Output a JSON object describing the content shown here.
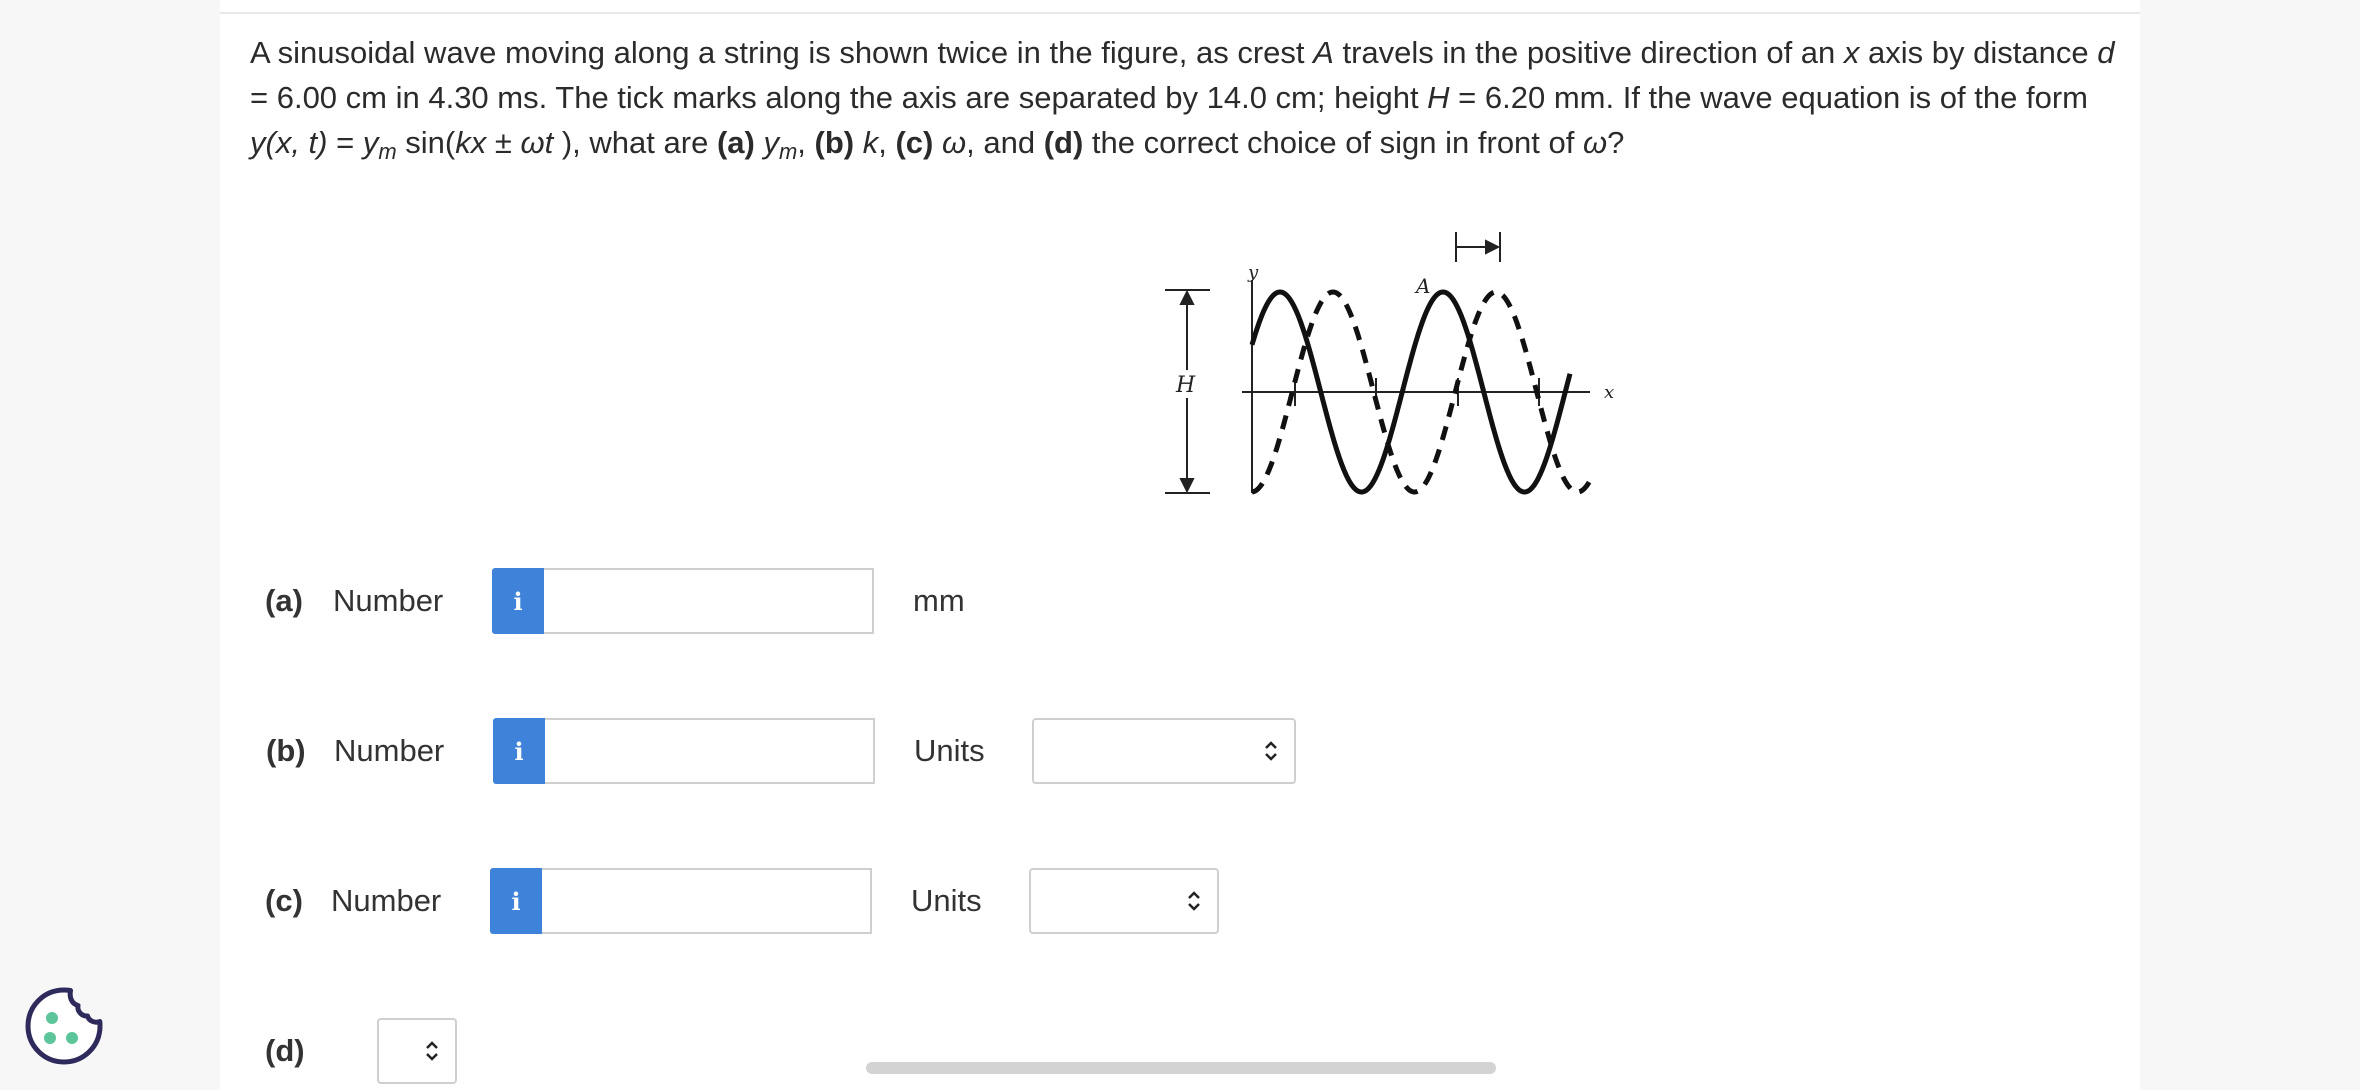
{
  "question": {
    "p1": "A sinusoidal wave moving along a string is shown twice in the figure, as crest ",
    "crest": "A",
    "p2": " travels in the positive direction of an ",
    "xvar": "x",
    "p3": " axis by distance ",
    "dvar": "d",
    "p4": " = 6.00 cm in 4.30 ms. The tick marks along the axis are separated by 14.0 cm; height ",
    "hvar": "H",
    "p5": " = 6.20 mm. If the wave equation is of the form ",
    "eq_y": "y(x, t)",
    "p6": " = ",
    "eq_ym": "y",
    "eq_ym_sub": "m",
    "p7": " sin(",
    "eq_kx": "kx ± ωt",
    "p8": " ), what are ",
    "a_label": "(a)",
    "p9": " ",
    "a_sym": "y",
    "a_sub": "m",
    "p10": ", ",
    "b_label": "(b)",
    "p11": " ",
    "b_sym": "k",
    "p12": ", ",
    "c_label": "(c)",
    "p13": " ",
    "c_sym": "ω",
    "p14": ", and ",
    "d_label": "(d)",
    "p15": " the correct choice of sign in front of ",
    "d_sym": "ω",
    "p16": "?"
  },
  "figure": {
    "label_y": "y",
    "label_x": "x",
    "label_A": "A",
    "label_H": "H"
  },
  "parts": {
    "a": {
      "label": "(a)",
      "number_label": "Number",
      "info_icon": "i",
      "value": "",
      "unit": "mm"
    },
    "b": {
      "label": "(b)",
      "number_label": "Number",
      "info_icon": "i",
      "value": "",
      "unit_label": "Units",
      "unit_selected": ""
    },
    "c": {
      "label": "(c)",
      "number_label": "Number",
      "info_icon": "i",
      "value": "",
      "unit_label": "Units",
      "unit_selected": ""
    },
    "d": {
      "label": "(d)",
      "selected": ""
    }
  },
  "icons": {
    "info": "info-icon",
    "select": "chevron-updown-icon",
    "cookie": "cookie-icon"
  },
  "colors": {
    "accent": "#3f82d9",
    "cookie_outline": "#2e2a5c",
    "cookie_dots": "#5cc59a"
  }
}
